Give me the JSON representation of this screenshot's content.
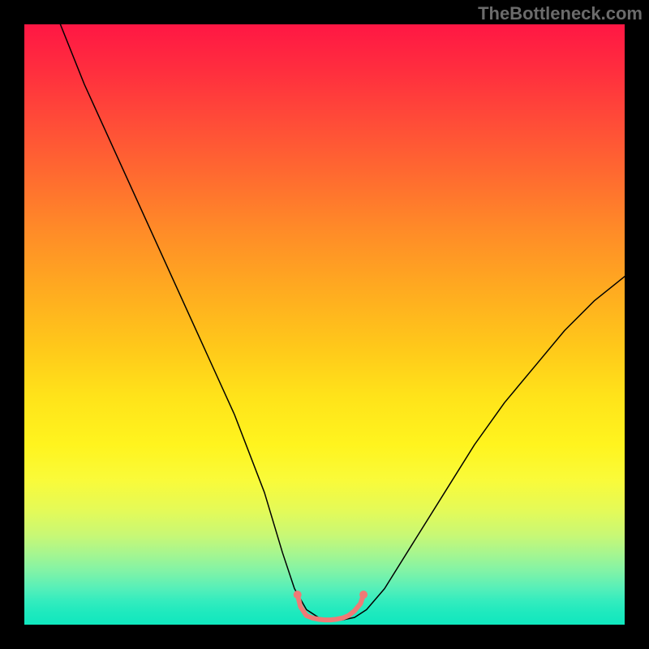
{
  "watermark": "TheBottleneck.com",
  "chart_data": {
    "type": "line",
    "title": "",
    "xlabel": "",
    "ylabel": "",
    "xlim": [
      0,
      100
    ],
    "ylim": [
      0,
      100
    ],
    "grid": false,
    "legend": false,
    "background": {
      "style": "vertical-gradient",
      "stops": [
        {
          "pos": 0.0,
          "color": "#ff1744"
        },
        {
          "pos": 0.25,
          "color": "#ff6a30"
        },
        {
          "pos": 0.55,
          "color": "#ffc91a"
        },
        {
          "pos": 0.8,
          "color": "#e4fa58"
        },
        {
          "pos": 1.0,
          "color": "#10e8bf"
        }
      ]
    },
    "series": [
      {
        "name": "bottleneck-curve",
        "color": "#000000",
        "width": 1.5,
        "x": [
          6,
          10,
          15,
          20,
          25,
          30,
          35,
          40,
          43,
          45,
          47,
          49,
          51,
          53,
          55,
          57,
          60,
          65,
          70,
          75,
          80,
          85,
          90,
          95,
          100
        ],
        "y": [
          100,
          90,
          79,
          68,
          57,
          46,
          35,
          22,
          12,
          6,
          2.5,
          1.2,
          0.8,
          0.8,
          1.2,
          2.5,
          6,
          14,
          22,
          30,
          37,
          43,
          49,
          54,
          58
        ]
      },
      {
        "name": "valley-marker",
        "color": "#ef7a76",
        "width": 6,
        "x": [
          45.5,
          46,
          47,
          48,
          49,
          50,
          51,
          52,
          53,
          54,
          55,
          56,
          56.5
        ],
        "y": [
          5.0,
          3.0,
          1.5,
          1.1,
          0.9,
          0.8,
          0.8,
          0.9,
          1.1,
          1.5,
          2.3,
          3.5,
          5.0
        ]
      }
    ],
    "markers": [
      {
        "name": "valley-start-dot",
        "x": 45.5,
        "y": 5.0,
        "r": 5,
        "color": "#ef7a76"
      },
      {
        "name": "valley-end-dot",
        "x": 56.5,
        "y": 5.0,
        "r": 5,
        "color": "#ef7a76"
      }
    ]
  }
}
